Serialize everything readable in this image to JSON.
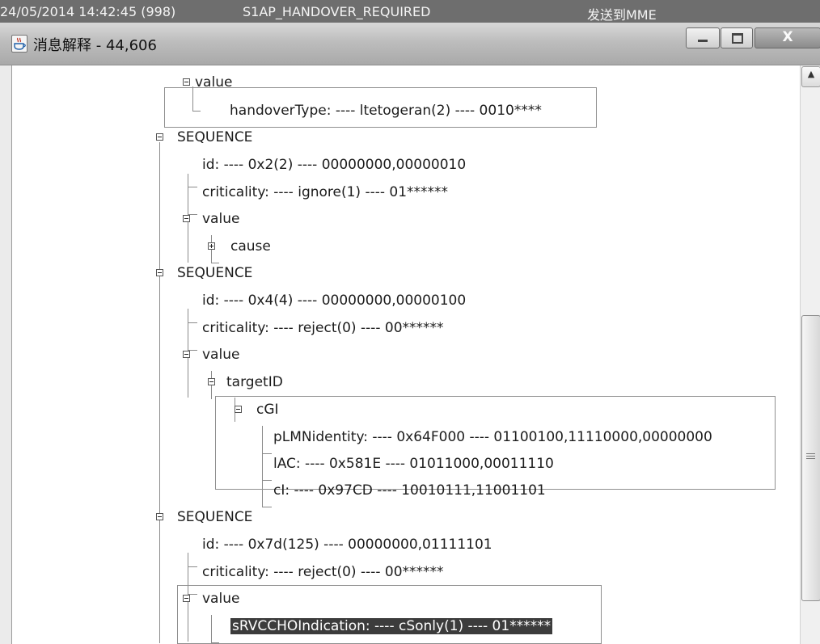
{
  "background_log": {
    "timestamp": "24/05/2014 14:42:45 (998)",
    "message_type": "S1AP_HANDOVER_REQUIRED",
    "direction": "发送到MME"
  },
  "window": {
    "title": "消息解释 - 44,606",
    "icon": "java-cup-icon",
    "controls": {
      "minimize": "minimize-icon",
      "maximize": "maximize-icon",
      "close_label": "X"
    }
  },
  "tree": {
    "nodes": [
      {
        "label": "value",
        "expanded": true
      },
      {
        "label": "handoverType: ---- ltetogeran(2) ---- 0010****"
      },
      {
        "label": "SEQUENCE",
        "expanded": true
      },
      {
        "label": "id: ---- 0x2(2) ---- 00000000,00000010"
      },
      {
        "label": "criticality: ---- ignore(1) ---- 01******"
      },
      {
        "label": "value",
        "expanded": true
      },
      {
        "label": "cause",
        "expanded": false
      },
      {
        "label": "SEQUENCE",
        "expanded": true
      },
      {
        "label": "id: ---- 0x4(4) ---- 00000000,00000100"
      },
      {
        "label": "criticality: ---- reject(0) ---- 00******"
      },
      {
        "label": "value",
        "expanded": true
      },
      {
        "label": "targetID",
        "expanded": true
      },
      {
        "label": "cGI",
        "expanded": true
      },
      {
        "label": "pLMNidentity: ---- 0x64F000 ---- 01100100,11110000,00000000"
      },
      {
        "label": "lAC: ---- 0x581E ---- 01011000,00011110"
      },
      {
        "label": "cI: ---- 0x97CD ---- 10010111,11001101"
      },
      {
        "label": "SEQUENCE",
        "expanded": true
      },
      {
        "label": "id: ---- 0x7d(125) ---- 00000000,01111101"
      },
      {
        "label": "criticality: ---- reject(0) ---- 00******"
      },
      {
        "label": "value",
        "expanded": true
      },
      {
        "label": "sRVCCHOIndication: ---- cSonly(1) ---- 01******",
        "selected": true
      }
    ]
  },
  "scrollbar": {
    "up_icon": "scroll-up-arrow-icon",
    "grip_icon": "scroll-grip-icon"
  },
  "colors": {
    "background_strip": "#6e6e6e",
    "titlebar": "#bdbdbd",
    "selection": "#3c3c3c",
    "tree_lines": "#8a8a8a",
    "tree_text": "#1c1c1c"
  }
}
